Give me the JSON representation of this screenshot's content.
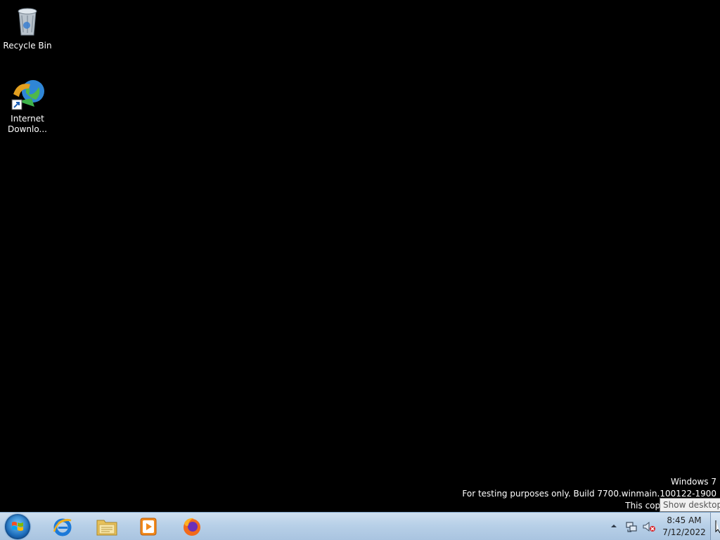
{
  "desktop": {
    "icons": [
      {
        "label": "Recycle Bin",
        "icon": "recycle-bin-icon"
      },
      {
        "label": "Internet Downlo...",
        "icon": "internet-download-manager-icon"
      }
    ],
    "watermark": {
      "line1": "Windows 7",
      "line2": "For testing purposes only. Build 7700.winmain.100122-1900",
      "line3": "This copy of Windows"
    }
  },
  "tooltip": {
    "text": "Show desktop"
  },
  "taskbar": {
    "start_icon": "windows-start-orb",
    "pinned": [
      {
        "name": "Internet Explorer",
        "icon": "internet-explorer-icon"
      },
      {
        "name": "Windows Explorer",
        "icon": "folder-icon"
      },
      {
        "name": "Windows Media Player",
        "icon": "media-player-icon"
      },
      {
        "name": "Firefox",
        "icon": "firefox-icon"
      }
    ],
    "tray": {
      "icons": [
        "show-hidden-icons-arrow",
        "network-icon",
        "volume-muted-icon"
      ],
      "time": "8:45 AM",
      "date": "7/12/2022"
    },
    "colors": {
      "taskbar": "#b8d0e8",
      "desktop": "#000000"
    }
  }
}
